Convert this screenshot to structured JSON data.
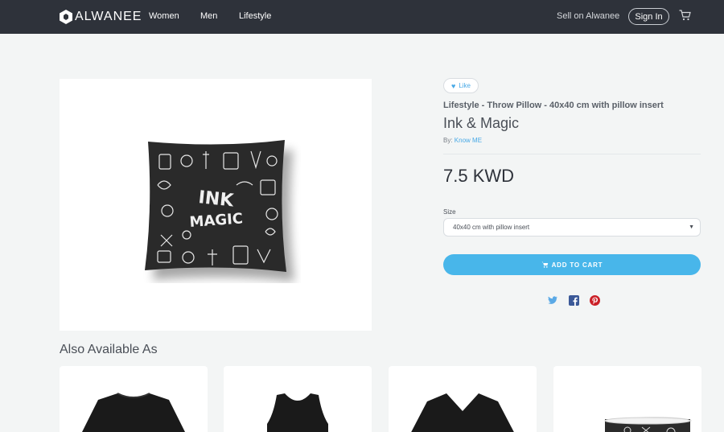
{
  "nav": {
    "logo_text": "ALWANEE",
    "links": [
      "Women",
      "Men",
      "Lifestyle"
    ],
    "sell_label": "Sell on Alwanee",
    "signin_label": "Sign In",
    "cart_icon": "cart-icon"
  },
  "product": {
    "like_label": "Like",
    "subtitle": "Lifestyle - Throw Pillow - 40x40 cm with pillow insert",
    "title": "Ink & Magic",
    "by_prefix": "By:",
    "artist": "Know ME",
    "price": "7.5 KWD",
    "size_label": "Size",
    "size_value": "40x40 cm with pillow insert",
    "add_to_cart_label": "ADD TO CART",
    "pillow_text_1": "INK",
    "pillow_text_2": "MAGIC",
    "share_icons": [
      "twitter-icon",
      "facebook-icon",
      "pinterest-icon"
    ]
  },
  "also_available": {
    "title": "Also Available As",
    "items": [
      "t-shirt",
      "tank-top",
      "v-neck-shirt",
      "mug"
    ]
  },
  "colors": {
    "nav_bg": "#2e323a",
    "accent": "#48b6ea",
    "page_bg": "#f3f5f5"
  }
}
